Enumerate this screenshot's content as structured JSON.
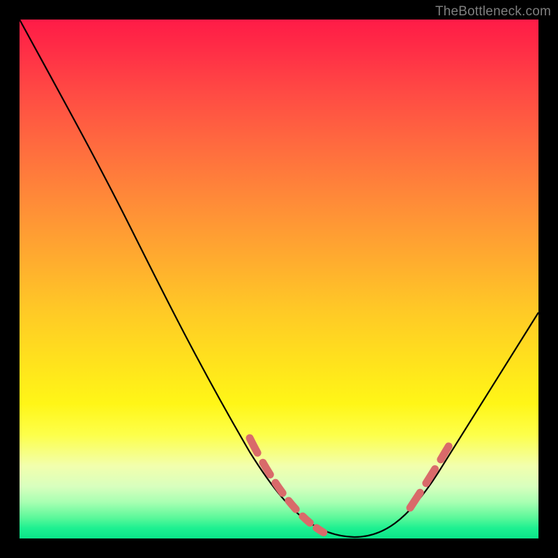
{
  "watermark": "TheBottleneck.com",
  "chart_data": {
    "type": "line",
    "title": "",
    "xlabel": "",
    "ylabel": "",
    "xlim": [
      0,
      100
    ],
    "ylim": [
      0,
      100
    ],
    "grid": false,
    "series": [
      {
        "name": "bottleneck-curve",
        "color": "#000000",
        "x": [
          0,
          4,
          8,
          12,
          16,
          20,
          24,
          28,
          32,
          36,
          40,
          44,
          48,
          52,
          56,
          60,
          64,
          68,
          72,
          76,
          80,
          84,
          88,
          92,
          96,
          100
        ],
        "values": [
          100,
          95,
          90,
          85,
          79,
          73,
          67,
          60,
          53,
          46,
          38,
          30,
          22,
          14,
          7,
          3,
          1,
          0,
          1,
          4,
          9,
          15,
          22,
          29,
          37,
          45
        ]
      }
    ],
    "highlight_segments": [
      {
        "name": "left-flank",
        "x_start": 47,
        "x_end": 62
      },
      {
        "name": "right-flank",
        "x_start": 72,
        "x_end": 80
      }
    ],
    "colors": {
      "highlight": "#d96a6a",
      "curve": "#000000",
      "background_top": "#ff1b47",
      "background_bottom": "#0ae489"
    }
  }
}
